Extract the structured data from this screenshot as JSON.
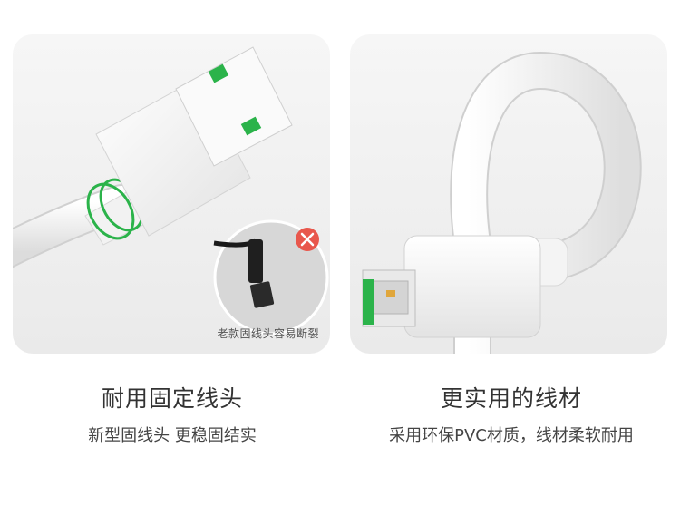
{
  "left_panel": {
    "inset_caption": "老款固线头容易断裂",
    "title": "耐用固定线头",
    "subtitle": "新型固线头 更稳固结实"
  },
  "right_panel": {
    "title": "更实用的线材",
    "subtitle": "采用环保PVC材质，线材柔软耐用"
  },
  "colors": {
    "accent_green": "#2bb34a",
    "x_badge_red": "#e8574c",
    "cable_white": "#f2f2f2",
    "panel_bg": "#efefef"
  },
  "icons": {
    "x_badge": "close-icon"
  }
}
